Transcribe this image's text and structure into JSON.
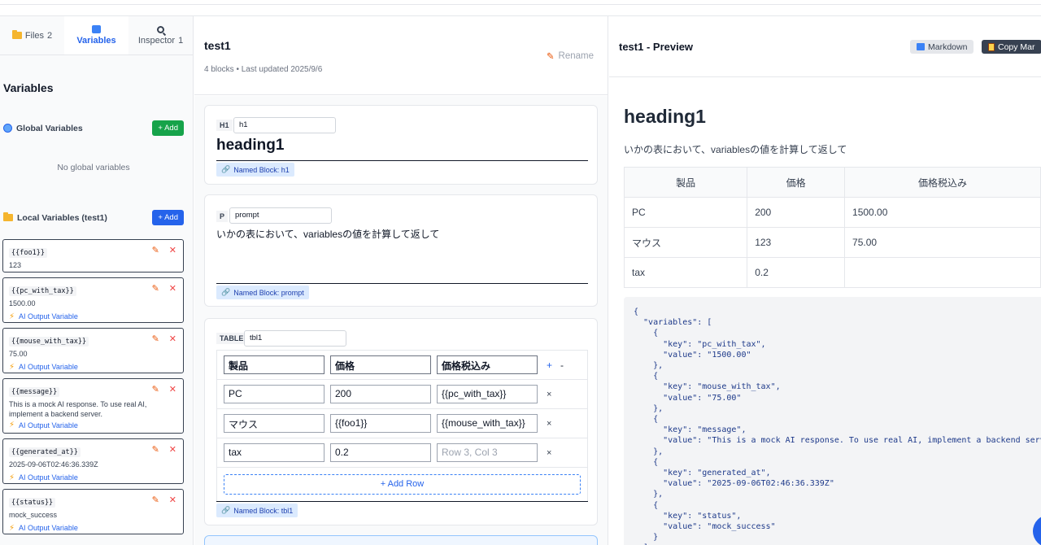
{
  "tabs": [
    {
      "label": "Files",
      "count": "2",
      "icon": "folder-icon"
    },
    {
      "label": "Variables",
      "count": "",
      "icon": "variables-icon"
    },
    {
      "label": "Inspector",
      "count": "1",
      "icon": "search-icon"
    }
  ],
  "sidebar": {
    "title": "Variables",
    "global": {
      "label": "Global Variables",
      "add": "+ Add",
      "empty": "No global variables"
    },
    "local": {
      "label": "Local Variables (test1)",
      "add": "+ Add"
    },
    "variables": [
      {
        "name": "{{foo1}}",
        "value": "123",
        "ai": ""
      },
      {
        "name": "{{pc_with_tax}}",
        "value": "1500.00",
        "ai": "AI Output Variable"
      },
      {
        "name": "{{mouse_with_tax}}",
        "value": "75.00",
        "ai": "AI Output Variable"
      },
      {
        "name": "{{message}}",
        "value": "This is a mock AI response. To use real AI, implement a backend server.",
        "ai": "AI Output Variable"
      },
      {
        "name": "{{generated_at}}",
        "value": "2025-09-06T02:46:36.339Z",
        "ai": "AI Output Variable"
      },
      {
        "name": "{{status}}",
        "value": "mock_success",
        "ai": "AI Output Variable"
      }
    ]
  },
  "editor": {
    "title": "test1",
    "meta": "4 blocks • Last updated 2025/9/6",
    "rename": "Rename",
    "blocks": {
      "h1": {
        "tag": "H1",
        "name": "h1",
        "text": "heading1",
        "named": "Named Block: h1"
      },
      "p": {
        "tag": "P",
        "name": "prompt",
        "text": "いかの表において、variablesの値を計算して返して",
        "named": "Named Block: prompt"
      },
      "table": {
        "tag": "TABLE",
        "name": "tbl1",
        "named": "Named Block: tbl1",
        "add_col": "+",
        "remove_col": "-",
        "remove_row": "×",
        "add_row": "+ Add Row",
        "header": [
          "製品",
          "価格",
          "価格税込み"
        ],
        "rows": [
          [
            "PC",
            "200",
            "{{pc_with_tax}}"
          ],
          [
            "マウス",
            "{{foo1}}",
            "{{mouse_with_tax}}"
          ],
          [
            "tax",
            "0.2",
            ""
          ]
        ],
        "placeholder": "Row 3, Col 3"
      }
    }
  },
  "preview": {
    "title": "test1 - Preview",
    "markdown_btn": "Markdown",
    "copy_btn": "Copy Mar",
    "h1": "heading1",
    "p": "いかの表において、variablesの値を計算して返して",
    "table": {
      "header": [
        "製品",
        "価格",
        "価格税込み"
      ],
      "rows": [
        [
          "PC",
          "200",
          "1500.00"
        ],
        [
          "マウス",
          "123",
          "75.00"
        ],
        [
          "tax",
          "0.2",
          ""
        ]
      ]
    },
    "code": "{\n  \"variables\": [\n    {\n      \"key\": \"pc_with_tax\",\n      \"value\": \"1500.00\"\n    },\n    {\n      \"key\": \"mouse_with_tax\",\n      \"value\": \"75.00\"\n    },\n    {\n      \"key\": \"message\",\n      \"value\": \"This is a mock AI response. To use real AI, implement a backend serv\n    },\n    {\n      \"key\": \"generated_at\",\n      \"value\": \"2025-09-06T02:46:36.339Z\"\n    },\n    {\n      \"key\": \"status\",\n      \"value\": \"mock_success\"\n    }\n  ]"
  }
}
